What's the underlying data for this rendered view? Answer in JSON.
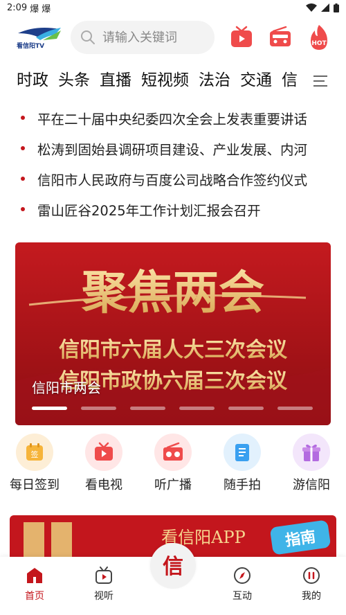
{
  "status_bar": {
    "time": "2:09",
    "notif_1": "爆",
    "notif_2": "爆"
  },
  "header": {
    "logo_text": "看信阳TV",
    "search_placeholder": "请输入关键词",
    "hot_badge": "HOT"
  },
  "channels": [
    {
      "label": "时政",
      "active": false
    },
    {
      "label": "头条",
      "active": true
    },
    {
      "label": "直播",
      "active": false
    },
    {
      "label": "短视频",
      "active": false
    },
    {
      "label": "法治",
      "active": false
    },
    {
      "label": "交通",
      "active": false
    },
    {
      "label": "信",
      "active": false
    }
  ],
  "headlines": [
    "平在二十届中央纪委四次全会上发表重要讲话",
    "松涛到固始县调研项目建设、产业发展、内河",
    "信阳市人民政府与百度公司战略合作签约仪式",
    "雷山匠谷2025年工作计划汇报会召开"
  ],
  "banner": {
    "big_title": "聚焦两会",
    "line_1": "信阳市六届人大三次会议",
    "line_2": "信阳市政协六届三次会议",
    "caption": "信阳市两会",
    "slide_count": 6,
    "active_slide": 0
  },
  "quick_actions": [
    {
      "label": "每日签到",
      "icon": "calendar-sign-icon",
      "color": "#f6a623",
      "bg": "#fdeed6",
      "glyph": "签"
    },
    {
      "label": "看电视",
      "icon": "tv-icon",
      "color": "#ef4b4b",
      "bg": "#ffe6e6"
    },
    {
      "label": "听广播",
      "icon": "radio-icon",
      "color": "#ef4b4b",
      "bg": "#ffe6e6"
    },
    {
      "label": "随手拍",
      "icon": "note-icon",
      "color": "#3aa0f0",
      "bg": "#e2f1fd"
    },
    {
      "label": "游信阳",
      "icon": "gift-icon",
      "color": "#b36be0",
      "bg": "#f3e6fb"
    }
  ],
  "promo": {
    "title": "看信阳APP",
    "badge": "指南"
  },
  "tabs": [
    {
      "label": "首页",
      "icon": "home-icon",
      "active": true
    },
    {
      "label": "视听",
      "icon": "video-icon",
      "active": false
    },
    {
      "label": "信",
      "icon": "center-logo-icon",
      "active": false
    },
    {
      "label": "互动",
      "icon": "compass-icon",
      "active": false
    },
    {
      "label": "我的",
      "icon": "profile-icon",
      "active": false
    }
  ],
  "colors": {
    "accent": "#c4161c",
    "banner_red": "#b3161b",
    "gold": "#f2d08a"
  }
}
